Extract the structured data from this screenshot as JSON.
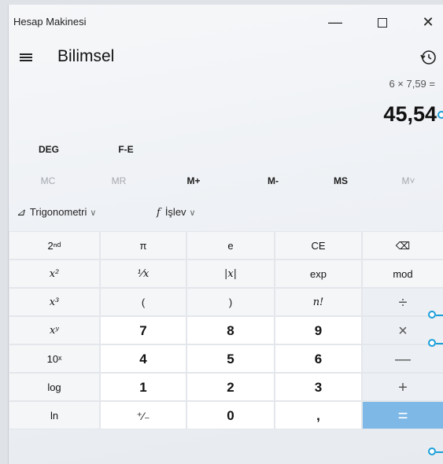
{
  "window": {
    "title": "Hesap Makinesi",
    "minimize": "—",
    "close": "✕"
  },
  "header": {
    "mode": "Bilimsel"
  },
  "display": {
    "expression": "6 × 7,59 =",
    "result": "45,54"
  },
  "angle_row": {
    "deg": "DEG",
    "fe": "F-E"
  },
  "memory_row": [
    "MC",
    "MR",
    "M+",
    "M-",
    "MS",
    "M˅"
  ],
  "funcbar": {
    "trig_icon": "⊿",
    "trig_label": "Trigonometri",
    "func_icon": "f",
    "func_label": "İşlev",
    "chevron": "∨"
  },
  "keypad": [
    [
      "2ⁿᵈ",
      "π",
      "e",
      "CE",
      "⌫"
    ],
    [
      "x²",
      "¹⁄x",
      "|x|",
      "exp",
      "mod"
    ],
    [
      "x³",
      "(",
      ")",
      "n!",
      "÷"
    ],
    [
      "xʸ",
      "7",
      "8",
      "9",
      "×"
    ],
    [
      "10ˣ",
      "4",
      "5",
      "6",
      "—"
    ],
    [
      "log",
      "1",
      "2",
      "3",
      "+"
    ],
    [
      "ln",
      "⁺⁄₋",
      "0",
      ",",
      "="
    ]
  ]
}
